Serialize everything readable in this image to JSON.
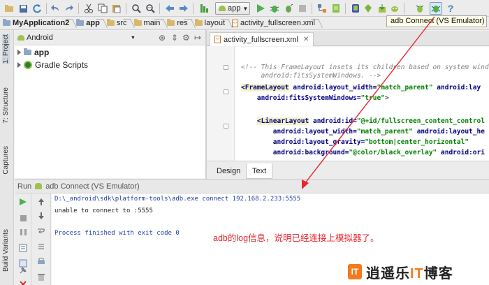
{
  "toolbar": {
    "run_config_label": "app",
    "tooltip": "adb Connect (VS Emulator)",
    "icons": [
      "open-icon",
      "save-icon",
      "sync-icon",
      "undo-icon",
      "redo-icon",
      "cut-icon",
      "copy-icon",
      "paste-icon",
      "find-icon",
      "replace-icon",
      "back-icon",
      "forward-icon",
      "make-icon",
      "run-icon",
      "debug-icon",
      "attach-icon",
      "stop-icon",
      "project-structure-icon",
      "sdk-manager-icon",
      "avd-manager-icon",
      "android-monitor-icon",
      "adb-connect-icon",
      "help-icon"
    ]
  },
  "breadcrumb": [
    "MyApplication2",
    "app",
    "src",
    "main",
    "res",
    "layout",
    "activity_fullscreen.xml"
  ],
  "left_tabs": [
    "1: Project",
    "7: Structure",
    "Captures",
    "Build Variants"
  ],
  "project_panel": {
    "view_mode": "Android",
    "tree": [
      "app",
      "Gradle Scripts"
    ]
  },
  "editor": {
    "tab": "activity_fullscreen.xml",
    "code_lines": [
      [
        {
          "c": "cmt",
          "t": "<!-- This FrameLayout insets its children based on system windows usin"
        }
      ],
      [
        {
          "c": "cmt",
          "t": "     android:fitsSystemWindows. -->"
        }
      ],
      [
        {
          "c": "tag",
          "t": "<FrameLayout"
        },
        {
          "c": "",
          "t": " "
        },
        {
          "c": "attr",
          "t": "android:layout_width="
        },
        {
          "c": "val",
          "t": "\"match_parent\""
        },
        {
          "c": "",
          "t": " "
        },
        {
          "c": "attr",
          "t": "android:lay"
        }
      ],
      [
        {
          "c": "",
          "t": "    "
        },
        {
          "c": "attr",
          "t": "android:fitsSystemWindows="
        },
        {
          "c": "val",
          "t": "\"true\""
        },
        {
          "c": "",
          "t": ">"
        }
      ],
      [
        {
          "c": "",
          "t": ""
        }
      ],
      [
        {
          "c": "",
          "t": "    "
        },
        {
          "c": "tag",
          "t": "<LinearLayout"
        },
        {
          "c": "",
          "t": " "
        },
        {
          "c": "attr",
          "t": "android:id="
        },
        {
          "c": "val",
          "t": "\"@+id/fullscreen_content_control"
        }
      ],
      [
        {
          "c": "",
          "t": "        "
        },
        {
          "c": "attr",
          "t": "android:layout_width="
        },
        {
          "c": "val",
          "t": "\"match_parent\""
        },
        {
          "c": "",
          "t": " "
        },
        {
          "c": "attr",
          "t": "android:layout_he"
        }
      ],
      [
        {
          "c": "",
          "t": "        "
        },
        {
          "c": "attr",
          "t": "android:layout_gravity="
        },
        {
          "c": "val",
          "t": "\"bottom|center_horizontal\""
        }
      ],
      [
        {
          "c": "",
          "t": "        "
        },
        {
          "c": "attr",
          "t": "android:background="
        },
        {
          "c": "val",
          "t": "\"@color/black_overlay\""
        },
        {
          "c": "",
          "t": " "
        },
        {
          "c": "attr",
          "t": "android:ori"
        }
      ]
    ],
    "bottom_tabs": [
      "Design",
      "Text"
    ]
  },
  "run_panel": {
    "prefix": "Run",
    "title": "adb Connect (VS Emulator)",
    "console_lines": [
      {
        "color": "#1f3fa8",
        "text": "D:\\_android\\sdk\\platform-tools\\adb.exe connect 192.168.2.233:5555"
      },
      {
        "color": "#222222",
        "text": "unable to connect to :5555"
      },
      {
        "color": "#1f3fa8",
        "text": "Process finished with exit code 0"
      }
    ]
  },
  "annotation": "adb的log信息，说明已经连接上模拟器了。",
  "watermark": {
    "logo": "IT",
    "prefix": "逍遥乐",
    "accent": "IT",
    "suffix": "博客"
  },
  "colors": {
    "annotation": "#e8262b",
    "arrow": "#e8262b",
    "accent": "#f47a1f"
  }
}
